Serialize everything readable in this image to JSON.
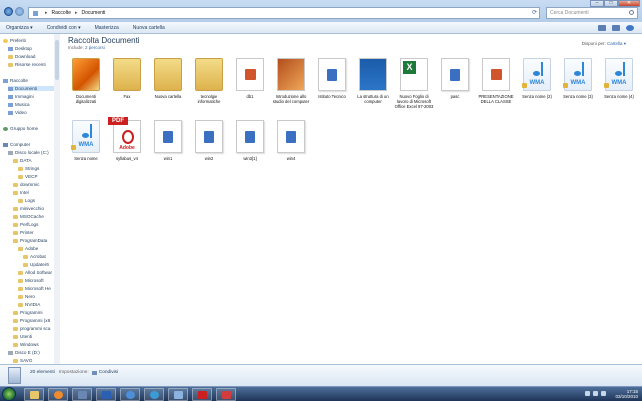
{
  "address": {
    "root_icon": "library-icon",
    "crumbs": [
      "Raccolte",
      "Documenti"
    ],
    "search_placeholder": "Cerca Documenti"
  },
  "toolbar": {
    "organize": "Organizza ▾",
    "share": "Condividi con ▾",
    "slideshow": "Masterizza",
    "new_folder": "Nuova cartella"
  },
  "sidebar": {
    "favorites": "Preferiti",
    "desktop": "Desktop",
    "download": "Download",
    "recent": "Risorse recenti",
    "libraries": "Raccolte",
    "documents": "Documenti",
    "images": "Immagini",
    "music": "Musica",
    "video": "Video",
    "homegroup": "Gruppo home",
    "computer": "Computer",
    "disk_c": "Disco locale (C:)",
    "data": "DATA",
    "strings": "Strings",
    "vecp": "VECP",
    "dowmmic": "dowmmic",
    "intel": "Intel",
    "logs": "Logs",
    "minivecchio": "minivecchio",
    "msocache": "MSOCache",
    "perflogs": "PerfLogs",
    "printer": "Printer",
    "programdata": "ProgramData",
    "adobe": "Adobe",
    "acrobat": "Acrobat",
    "updater6": "Updater6",
    "allod": "Allod Softwar",
    "microsoft": "Microsoft",
    "microsoft_help": "Microsoft He",
    "nero": "Nero",
    "nvidia": "NVIDIA",
    "programmi": "Programmi",
    "programmi_x86": "Programmi (x8",
    "programmi_sca": "programmi sca",
    "utenti": "Utenti",
    "windows": "Windows",
    "disk_e": "Disco E (D:)",
    "savg": "SAVG"
  },
  "main": {
    "title": "Raccolta Documenti",
    "includes_label": "Include:",
    "includes_link": "2 percorsi",
    "arrange_label": "Disponi per:",
    "arrange_value": "Cartella ▾"
  },
  "files": [
    {
      "name": "Documenti digitalizzati",
      "type": "folder-photo"
    },
    {
      "name": "Fax",
      "type": "folder"
    },
    {
      "name": "Nuova cartella",
      "type": "folder"
    },
    {
      "name": "tecnolgie informatiche",
      "type": "folder"
    },
    {
      "name": "db1",
      "type": "access"
    },
    {
      "name": "Introduzione allo studio del computer",
      "type": "ppt-img"
    },
    {
      "name": "Istituto Tecnico",
      "type": "doc"
    },
    {
      "name": "La struttura di un computer",
      "type": "ppt-blue"
    },
    {
      "name": "Nuovo Foglio di lavoro di Microsoft Office Excel 97-2003",
      "type": "xls"
    },
    {
      "name": "pasc",
      "type": "doc"
    },
    {
      "name": "PRESENTAZIONE DELLA CLASSE",
      "type": "ppt"
    },
    {
      "name": "Senza nome (2)",
      "type": "wma"
    },
    {
      "name": "Senza nome (3)",
      "type": "wma"
    },
    {
      "name": "Senza nome (4)",
      "type": "wma"
    },
    {
      "name": "Senza nome",
      "type": "wma"
    },
    {
      "name": "syllabus_v4",
      "type": "pdf"
    },
    {
      "name": "win1",
      "type": "doc"
    },
    {
      "name": "win2",
      "type": "doc"
    },
    {
      "name": "win3[1]",
      "type": "doc"
    },
    {
      "name": "win4",
      "type": "doc"
    }
  ],
  "wma_label": "WMA",
  "pdf_label": "PDF",
  "adobe_label": "Adobe",
  "status": {
    "count": "20 elementi",
    "settings": "Impostazione:",
    "shared": "Condivisi"
  },
  "taskbar": {
    "time": "17:15",
    "date": "03/10/2010"
  }
}
